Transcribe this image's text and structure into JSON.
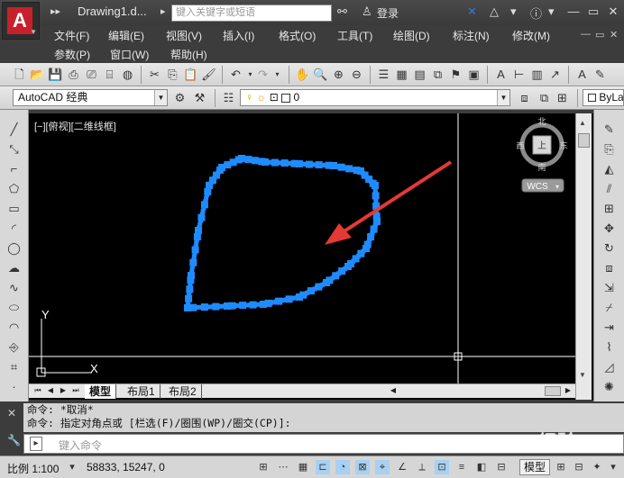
{
  "app": {
    "doc_title": "Drawing1.d...",
    "search_placeholder": "键入关键字或短语",
    "login": "登录"
  },
  "menus": {
    "row1": [
      "文件(F)",
      "编辑(E)",
      "视图(V)",
      "插入(I)",
      "格式(O)",
      "工具(T)",
      "绘图(D)",
      "标注(N)",
      "修改(M)"
    ],
    "row2": [
      "参数(P)",
      "窗口(W)",
      "帮助(H)"
    ]
  },
  "toolbar2": {
    "workspace": "AutoCAD 经典",
    "layer": "0",
    "bylayer": "ByLa"
  },
  "viewport": {
    "label": "[−][俯视][二维线框]",
    "compass": {
      "north": "北",
      "south": "南",
      "east": "东",
      "west": "西",
      "center": "上"
    },
    "wcs": "WCS",
    "ucs_x": "X",
    "ucs_y": "Y"
  },
  "layout_tabs": [
    "模型",
    "布局1",
    "布局2"
  ],
  "command": {
    "history": [
      "命令: *取消*",
      "命令: 指定对角点或 [栏选(F)/圈围(WP)/圈交(CP)]:"
    ],
    "input_placeholder": "键入命令"
  },
  "statusbar": {
    "scale": "比例 1:100",
    "coords": "58833, 15247, 0",
    "model": "模型"
  },
  "watermark": "Baidu经验",
  "colors": {
    "accent": "#1e8cff",
    "arrow": "#e53935",
    "logo": "#c8202a"
  }
}
